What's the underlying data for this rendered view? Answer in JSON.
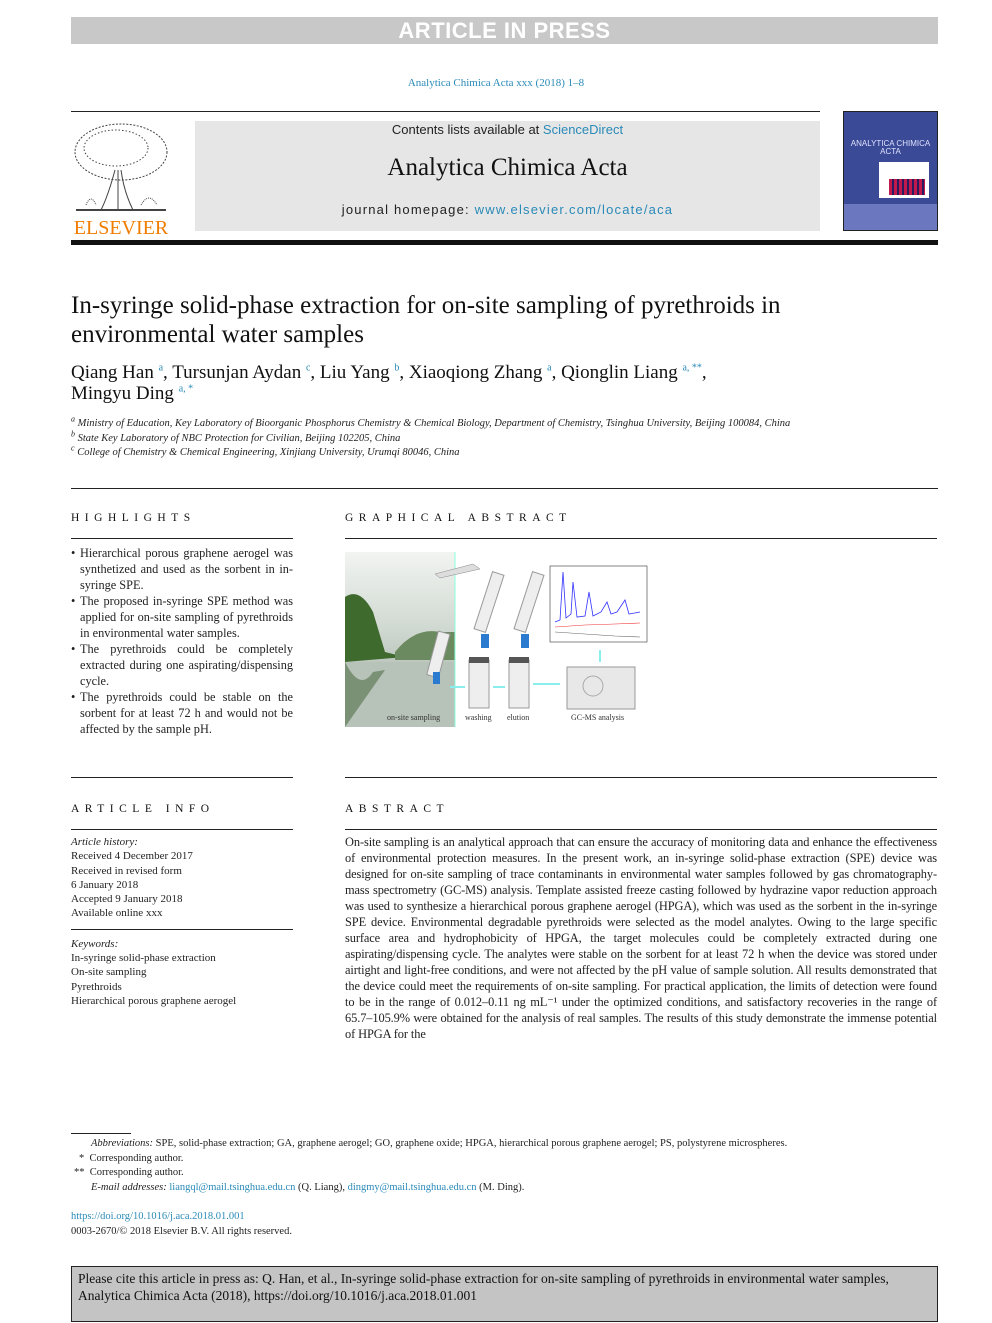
{
  "banner_top": "ARTICLE IN PRESS",
  "journal_ref": "Analytica Chimica Acta xxx (2018) 1–8",
  "header": {
    "contents_prefix": "Contents lists available at ",
    "contents_link": "ScienceDirect",
    "journal_title": "Analytica Chimica Acta",
    "homepage_prefix": "journal homepage: ",
    "homepage_link": "www.elsevier.com/locate/aca",
    "publisher": "ELSEVIER",
    "cover_title": "ANALYTICA CHIMICA ACTA"
  },
  "title": "In-syringe solid-phase extraction for on-site sampling of pyrethroids in environmental water samples",
  "authors": [
    {
      "name": "Qiang Han",
      "sup": "a"
    },
    {
      "name": "Tursunjan Aydan",
      "sup": "c"
    },
    {
      "name": "Liu Yang",
      "sup": "b"
    },
    {
      "name": "Xiaoqiong Zhang",
      "sup": "a"
    },
    {
      "name": "Qionglin Liang",
      "sup": "a, **"
    },
    {
      "name": "Mingyu Ding",
      "sup": "a, *"
    }
  ],
  "affiliations": [
    {
      "sup": "a",
      "text": "Ministry of Education, Key Laboratory of Bioorganic Phosphorus Chemistry & Chemical Biology, Department of Chemistry, Tsinghua University, Beijing 100084, China"
    },
    {
      "sup": "b",
      "text": "State Key Laboratory of NBC Protection for Civilian, Beijing 102205, China"
    },
    {
      "sup": "c",
      "text": "College of Chemistry & Chemical Engineering, Xinjiang University, Urumqi 80046, China"
    }
  ],
  "highlights": {
    "heading": "HIGHLIGHTS",
    "items": [
      "Hierarchical porous graphene aerogel was synthetized and used as the sorbent in in-syringe SPE.",
      "The proposed in-syringe SPE method was applied for on-site sampling of pyrethroids in environmental water samples.",
      "The pyrethroids could be completely extracted during one aspirating/dispensing cycle.",
      "The pyrethroids could be stable on the sorbent for at least 72 h and would not be affected by the sample pH."
    ]
  },
  "graphical_abstract": {
    "heading": "GRAPHICAL ABSTRACT",
    "labels": [
      "on-site sampling",
      "washing",
      "elution",
      "GC-MS analysis"
    ]
  },
  "article_info": {
    "heading": "ARTICLE INFO",
    "history_label": "Article history:",
    "history": [
      "Received 4 December 2017",
      "Received in revised form",
      "6 January 2018",
      "Accepted 9 January 2018",
      "Available online xxx"
    ],
    "keywords_label": "Keywords:",
    "keywords": [
      "In-syringe solid-phase extraction",
      "On-site sampling",
      "Pyrethroids",
      "Hierarchical porous graphene aerogel"
    ]
  },
  "abstract": {
    "heading": "ABSTRACT",
    "text": "On-site sampling is an analytical approach that can ensure the accuracy of monitoring data and enhance the effectiveness of environmental protection measures. In the present work, an in-syringe solid-phase extraction (SPE) device was designed for on-site sampling of trace contaminants in environmental water samples followed by gas chromatography-mass spectrometry (GC-MS) analysis. Template assisted freeze casting followed by hydrazine vapor reduction approach was used to synthesize a hierarchical porous graphene aerogel (HPGA), which was used as the sorbent in the in-syringe SPE device. Environmental degradable pyrethroids were selected as the model analytes. Owing to the large specific surface area and hydrophobicity of HPGA, the target molecules could be completely extracted during one aspirating/dispensing cycle. The analytes were stable on the sorbent for at least 72 h when the device was stored under airtight and light-free conditions, and were not affected by the pH value of sample solution. All results demonstrated that the device could meet the requirements of on-site sampling. For practical application, the limits of detection were found to be in the range of 0.012–0.11 ng mL⁻¹ under the optimized conditions, and satisfactory recoveries in the range of 65.7–105.9% were obtained for the analysis of real samples. The results of this study demonstrate the immense potential of HPGA for the"
  },
  "footnotes": {
    "abbrev_label": "Abbreviations:",
    "abbrev": " SPE, solid-phase extraction; GA, graphene aerogel; GO, graphene oxide; HPGA, hierarchical porous graphene aerogel; PS, polystyrene microspheres.",
    "corr1_mark": "*",
    "corr1": "Corresponding author.",
    "corr2_mark": "**",
    "corr2": "Corresponding author.",
    "email_label": "E-mail addresses:",
    "email1": "liangql@mail.tsinghua.edu.cn",
    "email1_who": " (Q. Liang), ",
    "email2": "dingmy@mail.tsinghua.edu.cn",
    "email2_who": " (M. Ding)."
  },
  "doi": "https://doi.org/10.1016/j.aca.2018.01.001",
  "copyright": "0003-2670/© 2018 Elsevier B.V. All rights reserved.",
  "cite": "Please cite this article in press as: Q. Han, et al., In-syringe solid-phase extraction for on-site sampling of pyrethroids in environmental water samples, Analytica Chimica Acta (2018), https://doi.org/10.1016/j.aca.2018.01.001",
  "colors": {
    "link": "#2a8ab8",
    "elsevier_orange": "#f07c00",
    "banner_gray": "#c8c8c8"
  }
}
